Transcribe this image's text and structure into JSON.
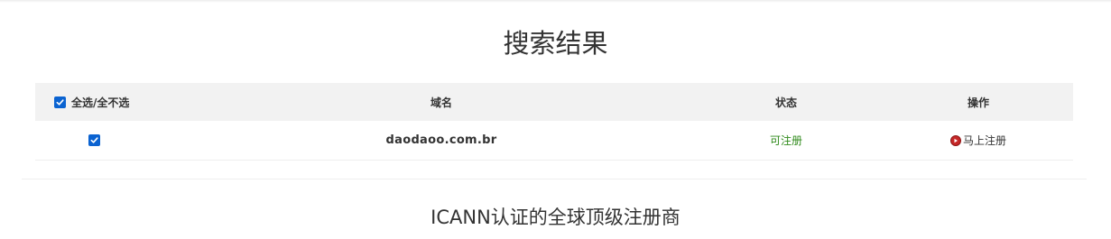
{
  "page": {
    "title": "搜索结果",
    "subtitle": "ICANN认证的全球顶级注册商"
  },
  "table": {
    "headers": {
      "select_all": "全选/全不选",
      "domain": "域名",
      "status": "状态",
      "action": "操作"
    },
    "rows": [
      {
        "checked": true,
        "domain": "daodaoo.com.br",
        "status": "可注册",
        "action": "马上注册"
      }
    ]
  },
  "colors": {
    "checkbox": "#0b63d1",
    "status_available": "#2f8a1b",
    "action_icon": "#c62828",
    "header_bg": "#f2f2f2"
  },
  "icons": {
    "checkbox": "checkbox-checked-icon",
    "action": "play-circle-icon"
  }
}
